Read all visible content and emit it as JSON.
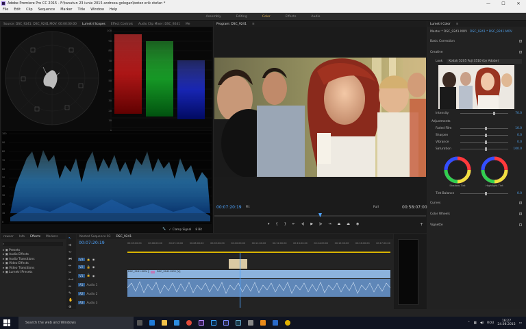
{
  "window": {
    "title": "Adobe Premiere Pro CC 2015 - F:\\tanutun 23 iunie 2015 andreea gologan\\botez erik stefan *",
    "controls": [
      "—",
      "☐",
      "✕"
    ]
  },
  "menu": [
    "File",
    "Edit",
    "Clip",
    "Sequence",
    "Marker",
    "Title",
    "Window",
    "Help"
  ],
  "workspaces": [
    {
      "label": "Assembly",
      "active": false
    },
    {
      "label": "Editing",
      "active": false
    },
    {
      "label": "Color",
      "active": true
    },
    {
      "label": "Effects",
      "active": false
    },
    {
      "label": "Audio",
      "active": false
    }
  ],
  "scopes_panel": {
    "tabs": [
      "Source: DSC_9241: DSC_9241.MOV: 00:00:00:00",
      "Lumetri Scopes",
      "Effect Controls",
      "Audio Clip Mixer: DSC_9241",
      "Me"
    ],
    "parade_ticks": [
      "100",
      "90",
      "80",
      "70",
      "60",
      "50",
      "40",
      "30",
      "20",
      "10",
      "0"
    ],
    "waveform_ticks": [
      "100",
      "90",
      "80",
      "70",
      "60",
      "50",
      "40",
      "30",
      "20",
      "10",
      "0"
    ],
    "clamp_label": "Clamp Signal",
    "bit_depth": "8 Bit"
  },
  "program": {
    "tab": "Program: DSC_9241",
    "timecode": "00:07:20:19",
    "fit": "Fit",
    "quality": "Full",
    "duration": "00:58:07:00"
  },
  "lumetri": {
    "tab": "Lumetri Color",
    "master": "Master * DSC_9241.MOV",
    "clip": "DSC_9241 * DSC_9241.MOV",
    "sections": {
      "basic": "Basic Correction",
      "creative": "Creative",
      "look_label": "Look",
      "look_value": "Kodak 5205 Fuji 3510 (by Adobe)",
      "intensity_label": "Intensity",
      "intensity_value": "70.0",
      "adjustments": "Adjustments",
      "faded_film_label": "Faded Film",
      "faded_film_value": "10.0",
      "sharpen_label": "Sharpen",
      "sharpen_value": "0.0",
      "vibrance_label": "Vibrance",
      "vibrance_value": "0.0",
      "saturation_label": "Saturation",
      "saturation_value": "100.0",
      "shadow_tint": "Shadow Tint",
      "highlight_tint": "Highlight Tint",
      "tint_balance_label": "Tint Balance",
      "tint_balance_value": "0.0",
      "curves": "Curves",
      "color_wheels": "Color Wheels",
      "vignette": "Vignette"
    }
  },
  "effects_panel": {
    "tabs": [
      "rowser",
      "Info",
      "Effects",
      "Markers"
    ],
    "items": [
      "Presets",
      "Audio Effects",
      "Audio Transitions",
      "Video Effects",
      "Video Transitions",
      "Lumetri Presets"
    ]
  },
  "timeline": {
    "tabs": [
      "Nested Sequence 03",
      "DSC_9241"
    ],
    "timecode": "00:07:20:19",
    "ruler": [
      "00:05:00:00",
      "00:06:00:00",
      "00:07:00:00",
      "00:08:00:00",
      "00:09:00:00",
      "00:10:00:00",
      "00:11:00:00",
      "00:12:00:00",
      "00:13:00:00",
      "00:14:00:00",
      "00:15:00:00",
      "00:16:00:00",
      "00:17:00:00"
    ],
    "tracks": [
      "V3",
      "V2",
      "V1",
      "A1",
      "A2",
      "A3"
    ],
    "clip_v1a": "DSC_9241.MOV [V]",
    "clip_v1b": "DSC_9241.MOV [V]",
    "audio_labels": [
      "Audio 1",
      "Audio 2",
      "Audio 3"
    ]
  },
  "taskbar": {
    "search_placeholder": "Search the web and Windows",
    "time": "16:27",
    "date": "24.08.2015",
    "lang": "ROU"
  }
}
